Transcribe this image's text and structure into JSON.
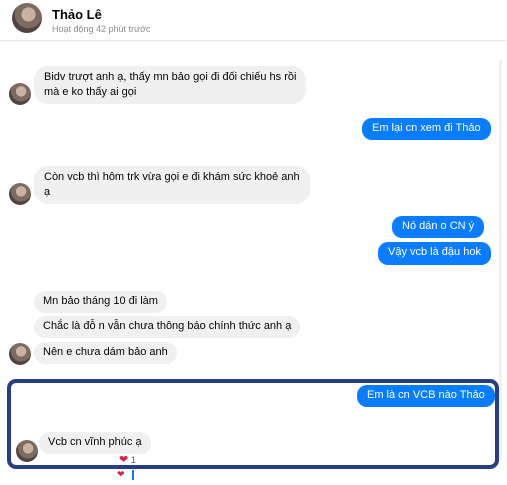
{
  "header": {
    "name": "Thảo Lê",
    "status": "Hoạt động 42 phút trước"
  },
  "messages": [
    {
      "text": "Bidv trượt anh ạ, thấy mn bảo gọi đi đối chiếu hs rồi"
    },
    {
      "text": "mà e ko thấy ai gọi"
    },
    {
      "text": "Em lại cn xem đi Thảo"
    },
    {
      "text": "Còn vcb thì hôm trk vừa gọi e đi khám sức khoẻ anh"
    },
    {
      "text": "ạ"
    },
    {
      "text": "Nó dán o CN ý"
    },
    {
      "text": "Vậy vcb là đậu hok"
    },
    {
      "text": "Mn bảo tháng 10 đi làm"
    },
    {
      "text": "Chắc là đỗ n vẫn chưa thông báo chính thức anh ạ"
    },
    {
      "text": "Nên e chưa dám bảo anh"
    },
    {
      "text": "Em là cn VCB nào Thảo"
    },
    {
      "text": "Vcb cn vĩnh phúc ạ"
    }
  ],
  "reaction": {
    "icon": "heart-icon",
    "count": "1",
    "color": "#e41e3f"
  },
  "colors": {
    "outgoing": "#0a7cff",
    "incoming": "#f0f0f0",
    "highlight_border": "#253f82"
  }
}
